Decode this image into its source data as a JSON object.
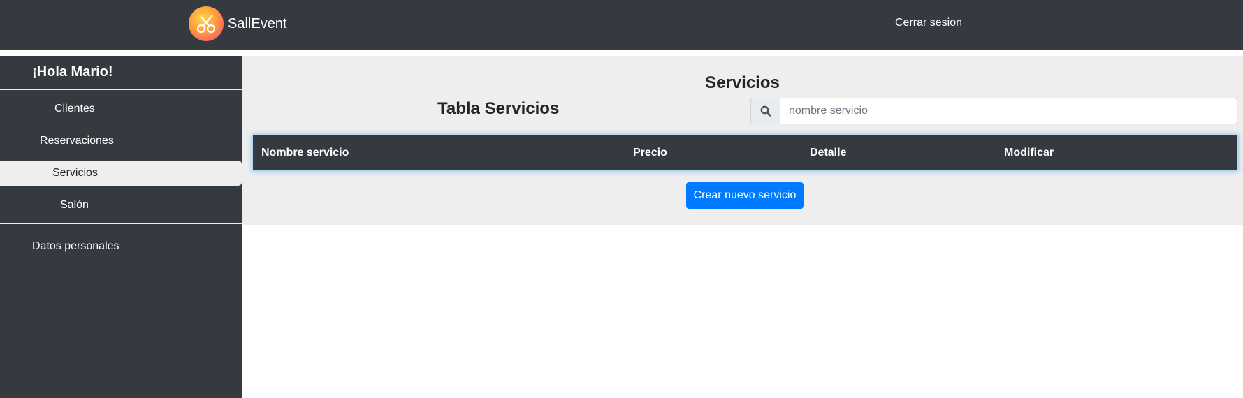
{
  "navbar": {
    "brand": "SallEvent",
    "logout": "Cerrar sesion"
  },
  "sidebar": {
    "greeting": "¡Hola Mario!",
    "items": [
      {
        "label": "Clientes"
      },
      {
        "label": "Reservaciones"
      },
      {
        "label": "Servicios",
        "active": true
      },
      {
        "label": "Salón"
      }
    ],
    "personal": "Datos personales"
  },
  "main": {
    "title": "Servicios",
    "table_title": "Tabla Servicios",
    "search": {
      "placeholder": "nombre servicio",
      "value": ""
    },
    "table": {
      "columns": [
        "Nombre servicio",
        "Precio",
        "Detalle",
        "Modificar"
      ],
      "rows": []
    },
    "create_button": "Crear nuevo servicio"
  },
  "colors": {
    "navbar_bg": "#343a40",
    "panel_bg": "#eeeeee",
    "primary": "#007bff"
  },
  "icons": {
    "logo": "salleevent-logo",
    "search": "search-icon"
  }
}
